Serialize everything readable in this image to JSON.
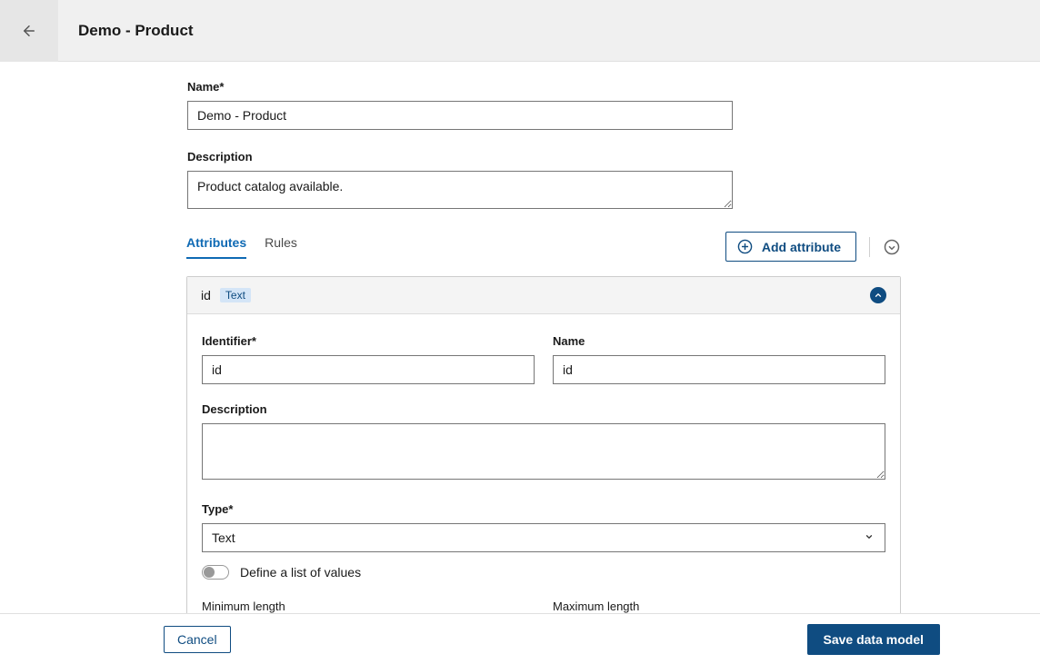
{
  "header": {
    "title": "Demo - Product"
  },
  "form": {
    "name": {
      "label": "Name*",
      "value": "Demo - Product"
    },
    "description": {
      "label": "Description",
      "value": "Product catalog available."
    }
  },
  "tabs": {
    "attributes": "Attributes",
    "rules": "Rules"
  },
  "actions": {
    "add_attribute": "Add attribute"
  },
  "attribute": {
    "header_id": "id",
    "header_type_badge": "Text",
    "identifier": {
      "label": "Identifier*",
      "value": "id"
    },
    "name": {
      "label": "Name",
      "value": "id"
    },
    "description": {
      "label": "Description",
      "value": ""
    },
    "type": {
      "label": "Type*",
      "value": "Text"
    },
    "define_values_label": "Define a list of values",
    "min_length": {
      "label": "Minimum length"
    },
    "max_length": {
      "label": "Maximum length"
    }
  },
  "footer": {
    "cancel": "Cancel",
    "save": "Save data model"
  }
}
